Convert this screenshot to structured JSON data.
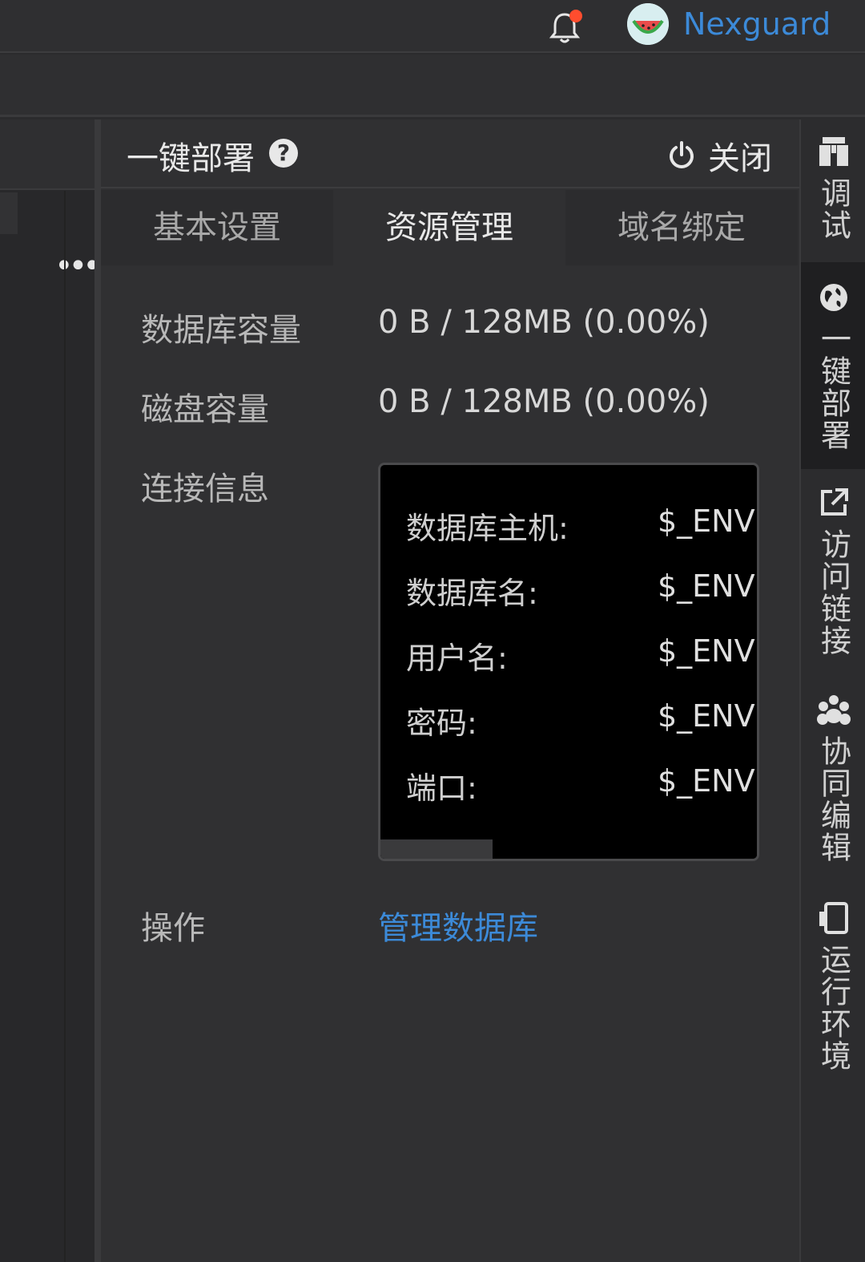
{
  "header": {
    "username": "Nexguard",
    "notification_icon": "bell-icon",
    "colors": {
      "accent": "#3c8ad8",
      "notify_dot": "#ff4d2e"
    }
  },
  "left": {
    "more_label": "•••"
  },
  "panel": {
    "title": "一键部署",
    "help_label": "?",
    "close_label": "关闭",
    "tabs": [
      {
        "label": "基本设置"
      },
      {
        "label": "资源管理",
        "active": true
      },
      {
        "label": "域名绑定"
      }
    ],
    "rows": {
      "db_capacity": {
        "label": "数据库容量",
        "value": "0 B / 128MB (0.00%)"
      },
      "disk_capacity": {
        "label": "磁盘容量",
        "value": "0 B / 128MB (0.00%)"
      },
      "connection": {
        "label": "连接信息"
      },
      "actions": {
        "label": "操作",
        "link": "管理数据库"
      }
    },
    "connection_info": [
      {
        "key": "数据库主机:",
        "value": "$_ENV"
      },
      {
        "key": "数据库名:",
        "value": "$_ENV"
      },
      {
        "key": "用户名:",
        "value": "$_ENV"
      },
      {
        "key": "密码:",
        "value": "$_ENV"
      },
      {
        "key": "端口:",
        "value": "$_ENV"
      }
    ]
  },
  "rightbar": {
    "items": [
      {
        "label": "调试",
        "icon": "debug-icon"
      },
      {
        "label": "一键部署",
        "icon": "globe-icon",
        "active": true
      },
      {
        "label": "访问链接",
        "icon": "external-link-icon"
      },
      {
        "label": "协同编辑",
        "icon": "team-icon"
      },
      {
        "label": "运行环境",
        "icon": "device-icon"
      }
    ]
  }
}
